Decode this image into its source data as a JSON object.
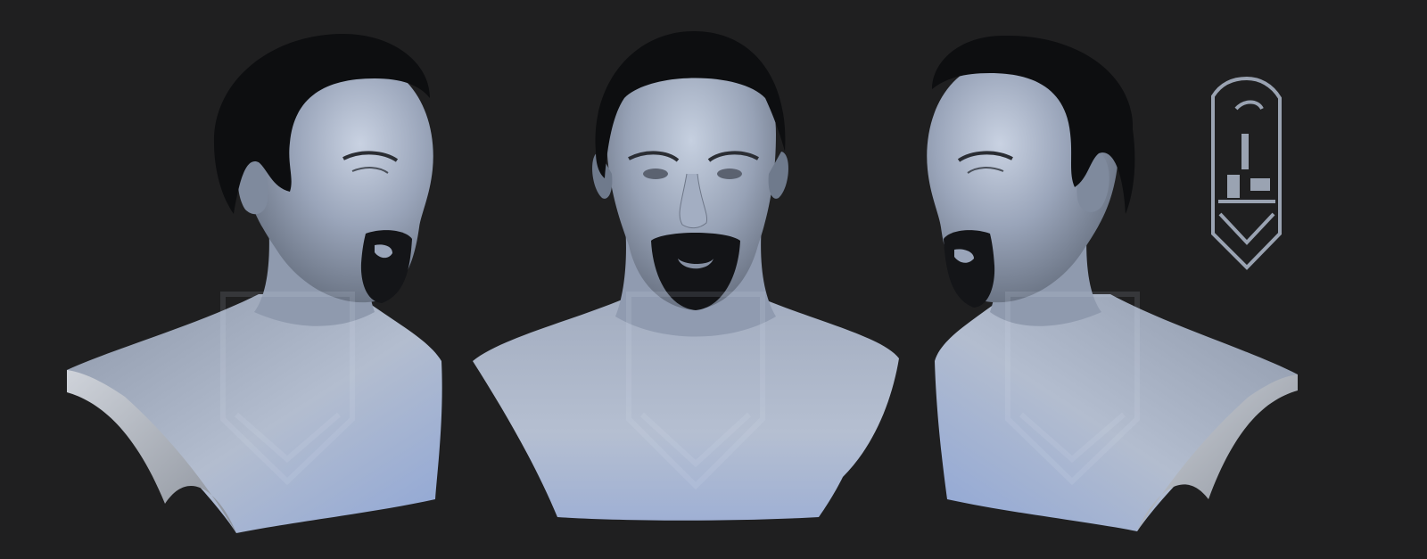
{
  "scene": {
    "description_free": true,
    "background_color": "#1f1f20",
    "clay_color": "#aab4c8",
    "hair_color": "#0d0e10",
    "logo_color": "#9aa3b2"
  },
  "views": [
    {
      "id": "three-quarter-left",
      "icon": "bust-three-quarter"
    },
    {
      "id": "front",
      "icon": "bust-front"
    },
    {
      "id": "three-quarter-right",
      "icon": "bust-three-quarter-mirrored"
    }
  ],
  "logo": {
    "icon": "shield-emblem-icon"
  }
}
